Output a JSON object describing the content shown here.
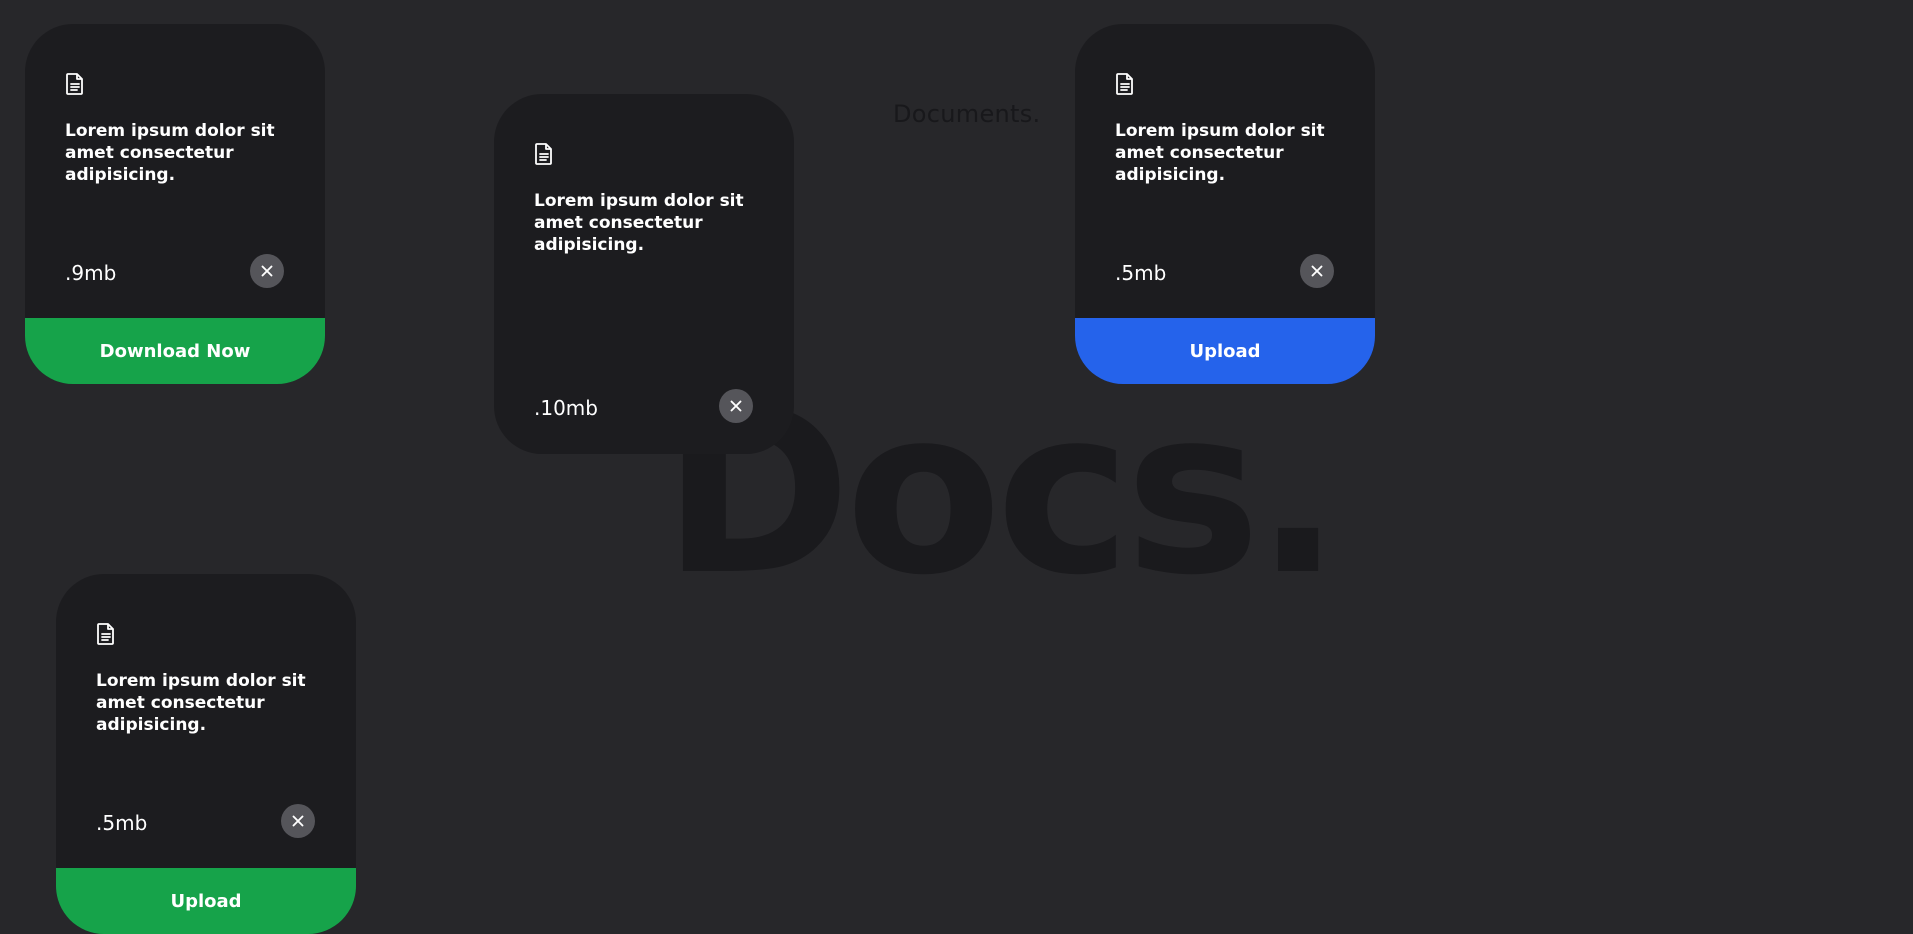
{
  "background": {
    "small_title": "Documents.",
    "big_title": "Docs."
  },
  "colors": {
    "page_background": "#27272a",
    "card_background": "#1c1c1f",
    "close_button": "#55555a",
    "green_action": "#16a34a",
    "blue_action": "#2563eb"
  },
  "cards": [
    {
      "icon": "document-icon",
      "description": "Lorem ipsum dolor sit amet consectetur adipisicing.",
      "size": ".9mb",
      "action_label": "Download Now",
      "action_color": "#16a34a"
    },
    {
      "icon": "document-icon",
      "description": "Lorem ipsum dolor sit amet consectetur adipisicing.",
      "size": ".10mb"
    },
    {
      "icon": "document-icon",
      "description": "Lorem ipsum dolor sit amet consectetur adipisicing.",
      "size": ".5mb",
      "action_label": "Upload",
      "action_color": "#2563eb"
    },
    {
      "icon": "document-icon",
      "description": "Lorem ipsum dolor sit amet consectetur adipisicing.",
      "size": ".5mb",
      "action_label": "Upload",
      "action_color": "#16a34a"
    }
  ]
}
